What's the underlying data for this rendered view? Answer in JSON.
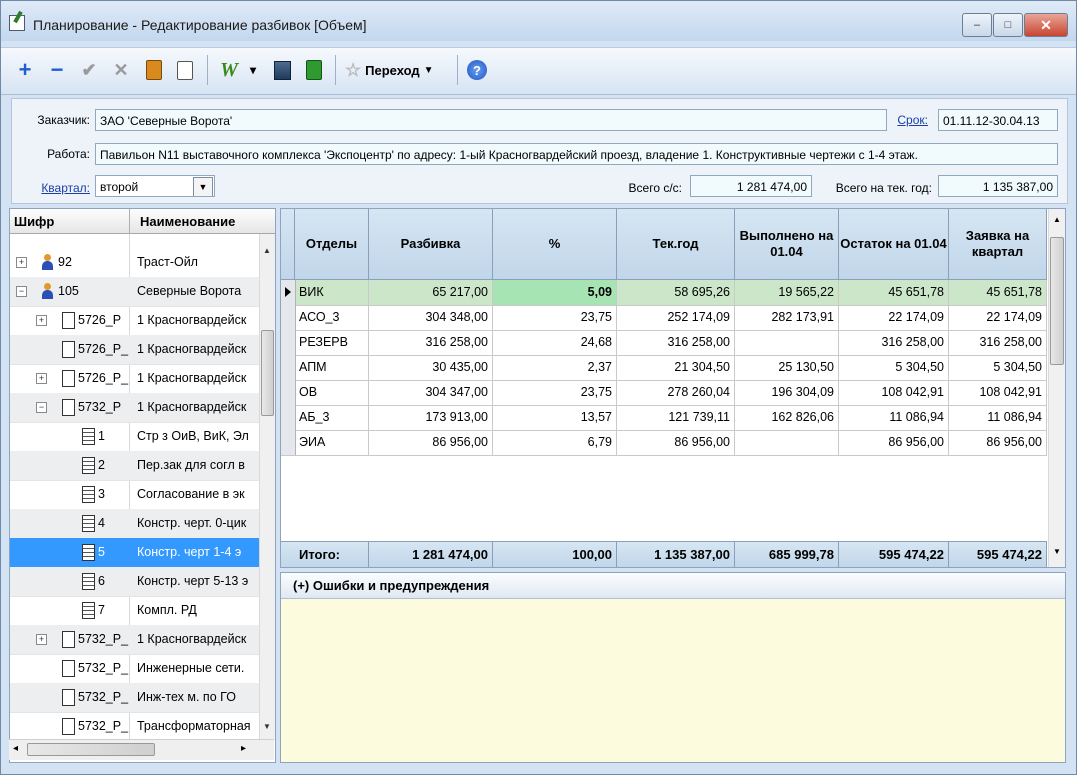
{
  "window": {
    "title": "Планирование - Редактирование разбивок [Объем]",
    "controls": {
      "minimize": "–",
      "maximize": "□",
      "close": "✕"
    }
  },
  "toolbar": {
    "add": "+",
    "remove": "−",
    "confirm": "✔",
    "cancel": "✕",
    "word_icon": "W",
    "dropdown": "▾",
    "perehod_label": "Переход",
    "help": "?"
  },
  "form": {
    "customer_label": "Заказчик:",
    "customer_value": "ЗАО 'Северные Ворота'",
    "term_label": "Срок:",
    "term_value": "01.11.12-30.04.13",
    "work_label": "Работа:",
    "work_value": "Павильон N11 выставочного комплекса 'Экспоцентр' по адресу: 1-ый Красногвардейский проезд, владение 1. Конструктивные чертежи с 1-4 этаж.",
    "quarter_label": "Квартал:",
    "quarter_value": "второй",
    "total_cs_label": "Всего с/с:",
    "total_cs_value": "1 281 474,00",
    "total_year_label": "Всего на тек. год:",
    "total_year_value": "1 135 387,00"
  },
  "tree": {
    "col_code": "Шифр",
    "col_name": "Наименование",
    "rows": [
      {
        "code": "92",
        "name": "Траст-Ойл"
      },
      {
        "code": "105",
        "name": "Северные Ворота"
      },
      {
        "code": "5726_Р",
        "name": "1 Красногвардейск"
      },
      {
        "code": "5726_Р_",
        "name": "1 Красногвардейск"
      },
      {
        "code": "5726_Р_",
        "name": "1 Красногвардейск"
      },
      {
        "code": "5732_Р",
        "name": "1 Красногвардейск"
      },
      {
        "code": "1",
        "name": "Стр з ОиВ, ВиК, Эл"
      },
      {
        "code": "2",
        "name": "Пер.зак для согл в"
      },
      {
        "code": "3",
        "name": "Согласование в эк"
      },
      {
        "code": "4",
        "name": "Констр. черт. 0-цик"
      },
      {
        "code": "5",
        "name": "Констр. черт 1-4 э"
      },
      {
        "code": "6",
        "name": "Констр. черт 5-13 э"
      },
      {
        "code": "7",
        "name": "Компл. РД"
      },
      {
        "code": "5732_Р_",
        "name": "1 Красногвардейск"
      },
      {
        "code": "5732_Р_",
        "name": "Инженерные сети."
      },
      {
        "code": "5732_Р_",
        "name": "Инж-тех м. по ГО"
      },
      {
        "code": "5732_Р_",
        "name": "Трансформаторная"
      }
    ]
  },
  "grid": {
    "headers": [
      "Отделы",
      "Разбивка",
      "%",
      "Тек.год",
      "Выполнено на 01.04",
      "Остаток на 01.04",
      "Заявка на квартал"
    ],
    "rows": [
      [
        "ВИК",
        "65 217,00",
        "5,09",
        "58 695,26",
        "19 565,22",
        "45 651,78",
        "45 651,78"
      ],
      [
        "АСО_3",
        "304 348,00",
        "23,75",
        "252 174,09",
        "282 173,91",
        "22 174,09",
        "22 174,09"
      ],
      [
        "РЕЗЕРВ",
        "316 258,00",
        "24,68",
        "316 258,00",
        "",
        "316 258,00",
        "316 258,00"
      ],
      [
        "АПМ",
        "30 435,00",
        "2,37",
        "21 304,50",
        "25 130,50",
        "5 304,50",
        "5 304,50"
      ],
      [
        "ОВ",
        "304 347,00",
        "23,75",
        "278 260,04",
        "196 304,09",
        "108 042,91",
        "108 042,91"
      ],
      [
        "АБ_3",
        "173 913,00",
        "13,57",
        "121 739,11",
        "162 826,06",
        "11 086,94",
        "11 086,94"
      ],
      [
        "ЭИА",
        "86 956,00",
        "6,79",
        "86 956,00",
        "",
        "86 956,00",
        "86 956,00"
      ]
    ],
    "footer": [
      "Итого:",
      "1 281 474,00",
      "100,00",
      "1 135 387,00",
      "685 999,78",
      "595 474,22",
      "595 474,22"
    ]
  },
  "errors": {
    "title": "(+)  Ошибки и предупреждения"
  }
}
